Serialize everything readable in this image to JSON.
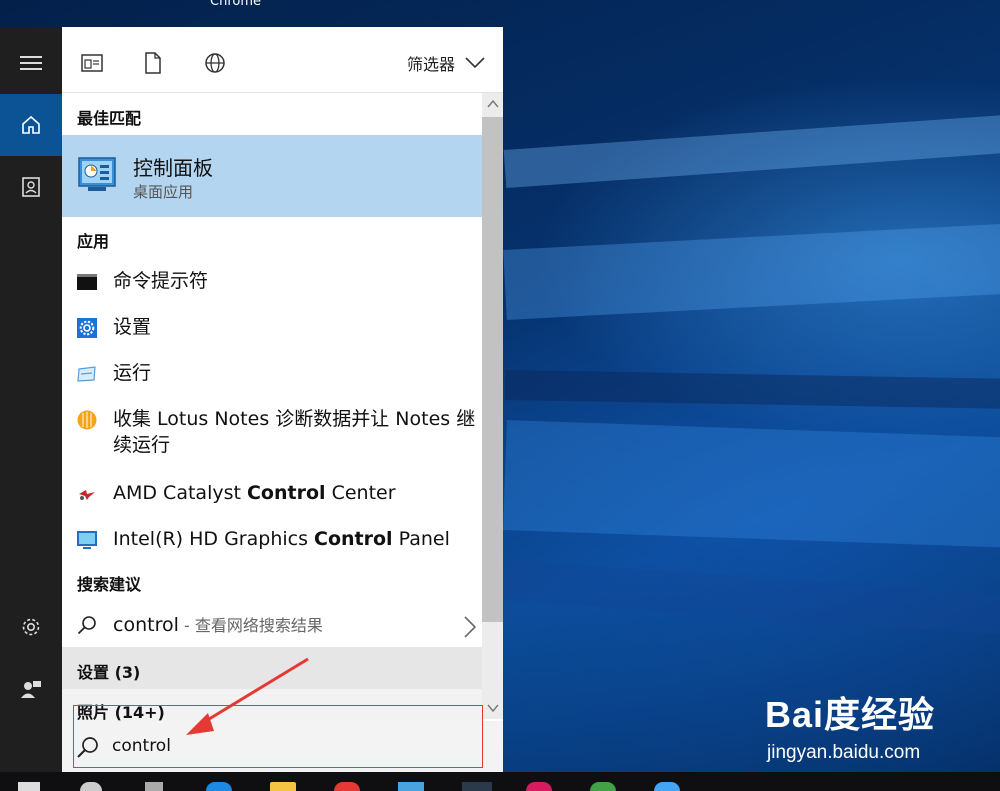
{
  "window_title": "Chrome",
  "filter_label": "筛选器",
  "sections": {
    "best_match": "最佳匹配",
    "apps": "应用",
    "search_suggestions": "搜索建议",
    "settings": "设置 (3)",
    "photos": "照片 (14+)"
  },
  "best_match": {
    "title": "控制面板",
    "subtitle": "桌面应用"
  },
  "apps": [
    {
      "label": "命令提示符",
      "icon": "cmd-icon"
    },
    {
      "label": "设置",
      "icon": "settings-gear-icon"
    },
    {
      "label": "运行",
      "icon": "run-icon"
    },
    {
      "label": "收集 Lotus Notes 诊断数据并让 Notes 继续运行",
      "icon": "lotus-notes-icon"
    },
    {
      "pre": "AMD Catalyst ",
      "bold": "Control",
      "post": " Center",
      "icon": "amd-catalyst-icon"
    },
    {
      "pre": "Intel(R) HD Graphics ",
      "bold": "Control",
      "post": " Panel",
      "icon": "intel-graphics-icon"
    }
  ],
  "suggestion": {
    "query": "control",
    "hint": " - 查看网络搜索结果"
  },
  "search": {
    "value": "control"
  },
  "watermark": {
    "logo": "Bai度经验",
    "url": "jingyan.baidu.com"
  },
  "colors": {
    "accent": "#0b5394",
    "best_match_bg": "#b4d5f0",
    "annotation": "#e53935"
  }
}
